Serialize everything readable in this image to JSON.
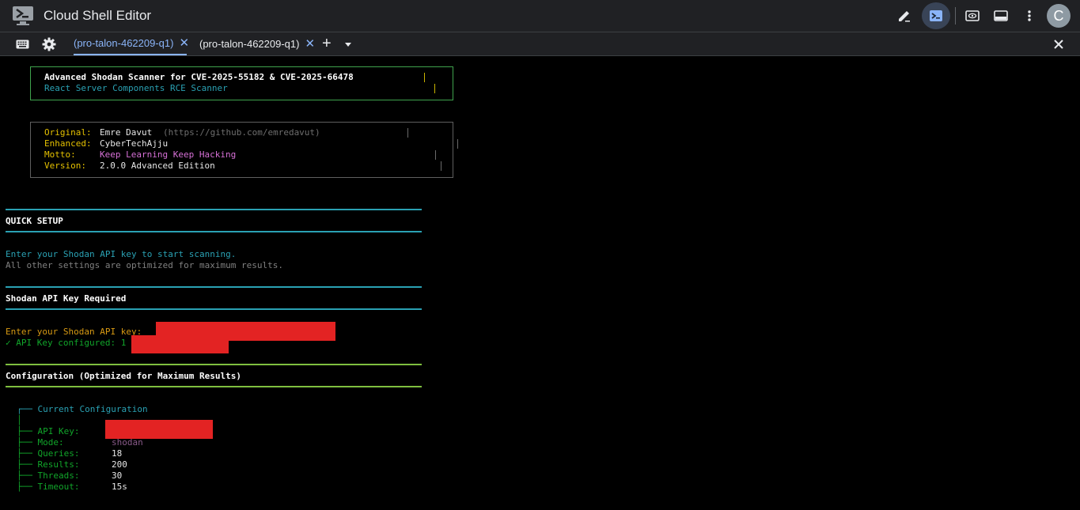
{
  "app": {
    "title": "Cloud Shell Editor",
    "avatar_letter": "C"
  },
  "tabs": [
    {
      "label": "(pro-talon-462209-q1)",
      "active": true
    },
    {
      "label": "(pro-talon-462209-q1)",
      "active": false
    }
  ],
  "tabbar": {
    "add_label": "+"
  },
  "icons": {
    "logo": "cloud-shell-logo-icon",
    "edit": "pencil-icon",
    "terminal": "terminal-icon",
    "preview": "web-preview-icon",
    "layout": "layout-icon",
    "menu": "more-vertical-icon",
    "keyboard": "keyboard-icon",
    "settings": "gear-icon",
    "close": "close-icon"
  },
  "colors": {
    "topbar_bg": "#202124",
    "accent": "#8ab4f8",
    "terminal_bg": "#000000",
    "redaction": "#e32323"
  },
  "terminal": {
    "banner": {
      "title": "Advanced Shodan Scanner for CVE-2025-55182 & CVE-2025-66478",
      "subtitle": "React Server Components RCE Scanner"
    },
    "info": {
      "original_label": "Original:",
      "original_value": "Emre Davut",
      "original_url": "(https://github.com/emredavut)",
      "enhanced_label": "Enhanced:",
      "enhanced_value": "CyberTechAjju",
      "motto_label": "Motto:",
      "motto_value": "Keep Learning Keep Hacking",
      "version_label": "Version:",
      "version_value": "2.0.0 Advanced Edition"
    },
    "quick_setup": {
      "heading": "QUICK SETUP",
      "line1": "Enter your Shodan API key to start scanning.",
      "line2": "All other settings are optimized for maximum results."
    },
    "api_key": {
      "heading": "Shodan API Key Required",
      "prompt": "Enter your Shodan API key:",
      "configured": "✓ API Key configured: 1"
    },
    "configuration": {
      "heading": "Configuration (Optimized for Maximum Results)",
      "tree_title": "┌── Current Configuration",
      "tree_pipe": "│",
      "items": [
        {
          "label": "├── API Key:",
          "value": ""
        },
        {
          "label": "├── Mode:",
          "value": "shodan"
        },
        {
          "label": "├── Queries:",
          "value": "18"
        },
        {
          "label": "├── Results:",
          "value": "200"
        },
        {
          "label": "├── Threads:",
          "value": "30"
        },
        {
          "label": "├── Timeout:",
          "value": "15s"
        }
      ]
    }
  }
}
